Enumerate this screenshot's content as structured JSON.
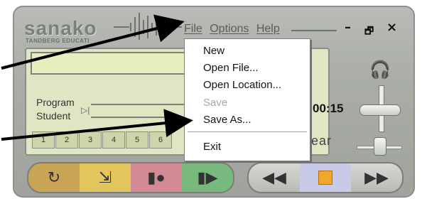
{
  "app": {
    "logo": "sanako",
    "logo_sub": "TANDBERG EDUCATI",
    "menus": [
      "File",
      "Options",
      "Help"
    ],
    "window_buttons": [
      "–",
      "🗗",
      "×"
    ]
  },
  "display": {
    "program_label": "Program",
    "student_label": "Student",
    "time": "00:15",
    "clear_label": "lear",
    "bookmarks": [
      "1",
      "2",
      "3",
      "4",
      "5",
      "6"
    ]
  },
  "file_menu": {
    "items": [
      {
        "label": "New",
        "enabled": true
      },
      {
        "label": "Open File...",
        "enabled": true
      },
      {
        "label": "Open Location...",
        "enabled": true
      },
      {
        "label": "Save",
        "enabled": false
      },
      {
        "label": "Save As...",
        "enabled": true
      },
      {
        "label": "Exit",
        "enabled": true
      }
    ]
  },
  "buttons": {
    "left_group": [
      "repeat-icon",
      "export-icon",
      "record-icon",
      "play-icon"
    ],
    "right_group": [
      "rewind-icon",
      "stop-icon",
      "fast-forward-icon"
    ]
  },
  "colors": {
    "shell": "#a9ada6",
    "display_bg": "#dfe6c3",
    "accent_orange": "#f2a72a"
  }
}
